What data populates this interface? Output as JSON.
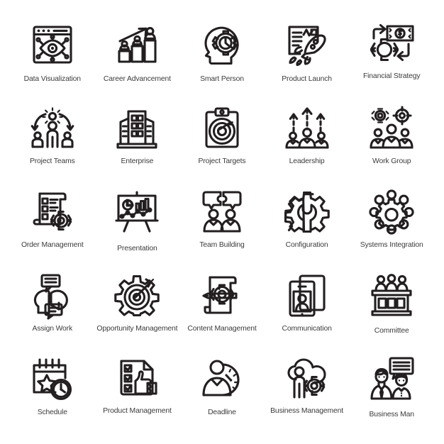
{
  "sheet": {
    "background": "#ffffff",
    "stroke_color": "#231f20",
    "label_color": "#3b3b3d",
    "columns": 5,
    "rows": 5,
    "icon_count": 25
  },
  "icons": [
    {
      "label": "Data Visualization",
      "icon": "browser-eye-network-icon"
    },
    {
      "label": "Career Advancement",
      "icon": "ascending-bars-people-arrow-icon"
    },
    {
      "label": "Smart Person",
      "icon": "head-gear-clock-icon"
    },
    {
      "label": "Product Launch",
      "icon": "rocket-document-icon"
    },
    {
      "label": "Financial Strategy",
      "icon": "banknote-gear-arrows-icon"
    },
    {
      "label": "Project Teams",
      "icon": "person-idea-arrows-team-icon"
    },
    {
      "label": "Enterprise",
      "icon": "office-building-icon"
    },
    {
      "label": "Project Targets",
      "icon": "clipboard-target-arrow-icon"
    },
    {
      "label": "Leadership",
      "icon": "people-rising-arrows-icon"
    },
    {
      "label": "Work Group",
      "icon": "people-gear-target-icon"
    },
    {
      "label": "Order Management",
      "icon": "scroll-list-gear-icon"
    },
    {
      "label": "Presentation",
      "icon": "easel-charts-icon"
    },
    {
      "label": "Team Building",
      "icon": "puzzle-speech-people-icon"
    },
    {
      "label": "Configuration",
      "icon": "gear-wrench-icon"
    },
    {
      "label": "Systems Integration",
      "icon": "gear-node-ring-icon"
    },
    {
      "label": "Assign Work",
      "icon": "two-heads-speech-bubbles-icon"
    },
    {
      "label": "Opportunity Management",
      "icon": "gear-target-dart-icon"
    },
    {
      "label": "Content Management",
      "icon": "scroll-pencil-gear-icon"
    },
    {
      "label": "Communication",
      "icon": "tablet-phone-contact-icon"
    },
    {
      "label": "Committee",
      "icon": "panel-bench-people-icon"
    },
    {
      "label": "Schedule",
      "icon": "calendar-star-clock-icon"
    },
    {
      "label": "Product Management",
      "icon": "checklist-thumbsup-icon"
    },
    {
      "label": "Deadline",
      "icon": "person-clock-icon"
    },
    {
      "label": "Business Management",
      "icon": "person-cloud-gear-icon"
    },
    {
      "label": "Business Man",
      "icon": "businessman-woman-speech-icon"
    }
  ]
}
